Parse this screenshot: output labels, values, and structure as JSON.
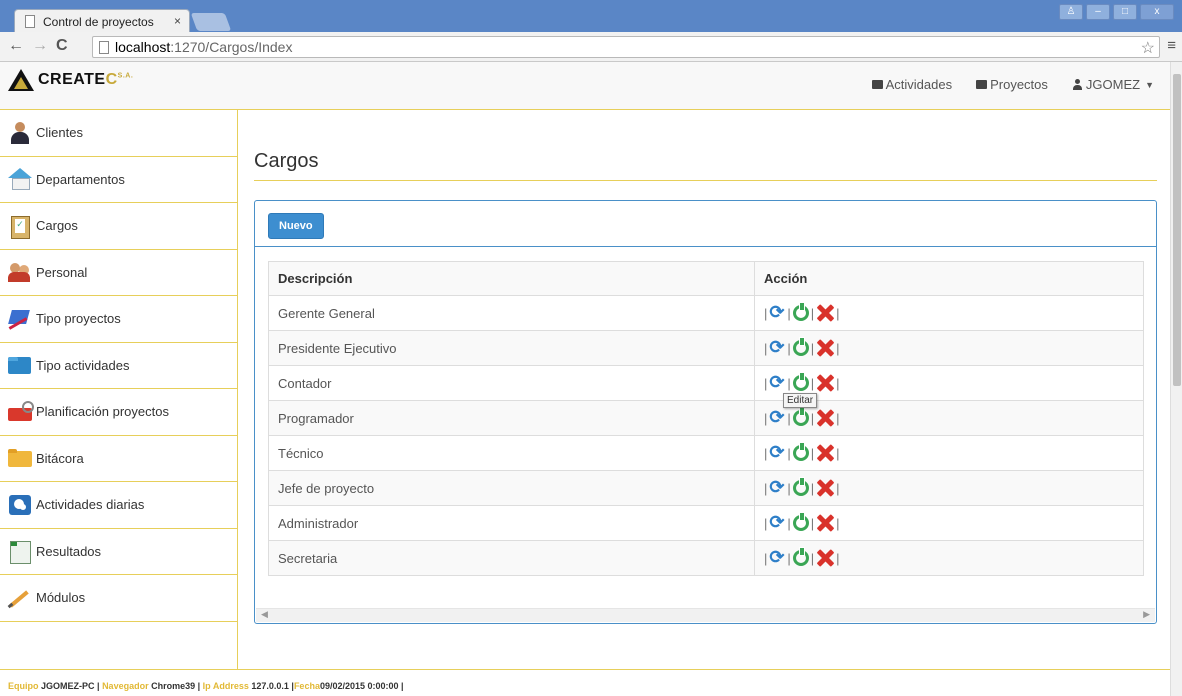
{
  "browser": {
    "tab_title": "Control de proyectos",
    "tab_close": "×",
    "url_host": "localhost",
    "url_rest": ":1270/Cargos/Index",
    "win_buttons": [
      "♙",
      "–",
      "□",
      "x"
    ]
  },
  "brand": {
    "name_main": "CREATE",
    "name_accent": "C",
    "suffix": "S.A."
  },
  "topnav": {
    "actividades": "Actividades",
    "proyectos": "Proyectos",
    "user": "JGOMEZ"
  },
  "sidebar": {
    "items": [
      {
        "label": "Clientes",
        "icon": "clients-icon"
      },
      {
        "label": "Departamentos",
        "icon": "house-icon"
      },
      {
        "label": "Cargos",
        "icon": "clipboard-icon"
      },
      {
        "label": "Personal",
        "icon": "people-icon"
      },
      {
        "label": "Tipo proyectos",
        "icon": "project-type-icon"
      },
      {
        "label": "Tipo actividades",
        "icon": "folder-icon"
      },
      {
        "label": "Planificación proyectos",
        "icon": "toolbox-icon"
      },
      {
        "label": "Bitácora",
        "icon": "folder-yellow-icon"
      },
      {
        "label": "Actividades diarias",
        "icon": "activities-icon"
      },
      {
        "label": "Resultados",
        "icon": "spreadsheet-icon"
      },
      {
        "label": "Módulos",
        "icon": "pencil-icon"
      }
    ]
  },
  "main": {
    "title": "Cargos",
    "new_button": "Nuevo",
    "table": {
      "headers": [
        "Descripción",
        "Acción"
      ],
      "rows": [
        "Gerente General",
        "Presidente Ejecutivo",
        "Contador",
        "Programador",
        "Técnico",
        "Jefe de proyecto",
        "Administrador",
        "Secretaria"
      ],
      "separator": "|"
    },
    "tooltip": "Editar"
  },
  "footer": {
    "equipo_label": "Equipo",
    "equipo": "JGOMEZ-PC",
    "nav_label": "Navegador",
    "nav": "Chrome39",
    "ip_label": "Ip Address",
    "ip": "127.0.0.1",
    "fecha_label": "Fecha",
    "fecha": "09/02/2015 0:00:00"
  },
  "colors": {
    "accent_gold": "#e7cf5a",
    "panel_blue": "#4a90c8",
    "button_blue": "#3d8ed0"
  }
}
